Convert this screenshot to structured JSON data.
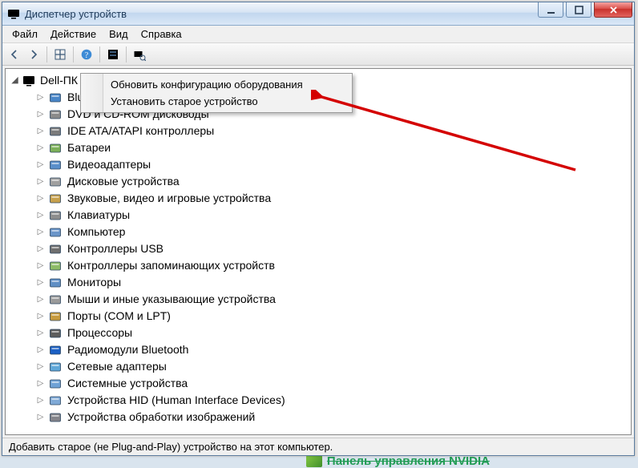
{
  "window": {
    "title": "Диспетчер устройств"
  },
  "menu": {
    "file": "Файл",
    "action": "Действие",
    "view": "Вид",
    "help": "Справка"
  },
  "tree": {
    "root": "Dell-ПК",
    "categories": [
      "Bluetooth-адаптеры",
      "DVD и CD-ROM дисководы",
      "IDE ATA/ATAPI контроллеры",
      "Батареи",
      "Видеоадаптеры",
      "Дисковые устройства",
      "Звуковые, видео и игровые устройства",
      "Клавиатуры",
      "Компьютер",
      "Контроллеры USB",
      "Контроллеры запоминающих устройств",
      "Мониторы",
      "Мыши и иные указывающие устройства",
      "Порты (COM и LPT)",
      "Процессоры",
      "Радиомодули Bluetooth",
      "Сетевые адаптеры",
      "Системные устройства",
      "Устройства HID (Human Interface Devices)",
      "Устройства обработки изображений"
    ]
  },
  "context_menu": {
    "scan": "Обновить конфигурацию оборудования",
    "legacy": "Установить старое устройство"
  },
  "statusbar": {
    "text": "Добавить старое (не Plug-and-Play) устройство на этот компьютер."
  },
  "background": {
    "nvidia_link": "Панель управления NVIDIA"
  },
  "icons": {
    "cat_colors": [
      "#4a86c7",
      "#8a8a8a",
      "#7b7b7b",
      "#7cb05a",
      "#5a8fca",
      "#a0a0a0",
      "#c7a14d",
      "#8d8d8d",
      "#6a95c9",
      "#6f6f6f",
      "#8dbb66",
      "#5f8fc5",
      "#9a9a9a",
      "#c69a3d",
      "#5d5d5d",
      "#1b60c4",
      "#5fa7d8",
      "#6fa2d6",
      "#7fa9d6",
      "#84848a"
    ]
  }
}
